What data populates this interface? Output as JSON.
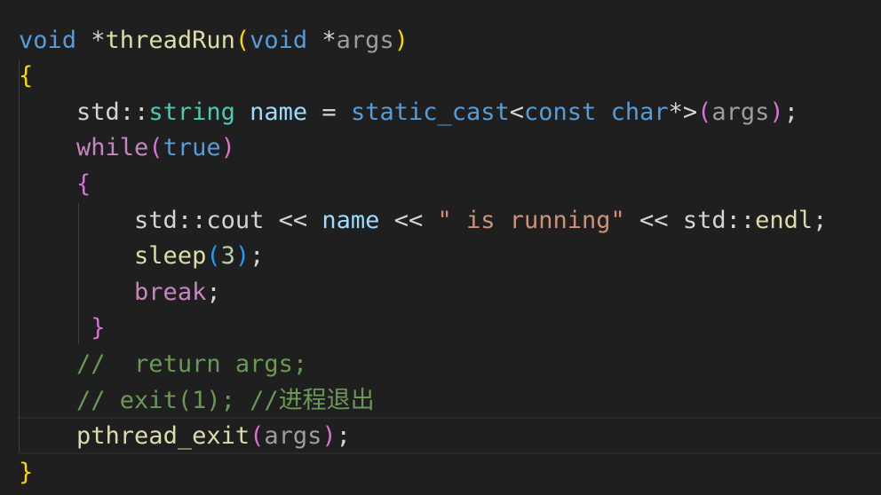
{
  "editor": {
    "language": "cpp",
    "theme": "dark",
    "background": "#1f1f1f",
    "lines": [
      [
        {
          "t": "void",
          "c": "kw"
        },
        {
          "t": " *",
          "c": "op"
        },
        {
          "t": "threadRun",
          "c": "fn"
        },
        {
          "t": "(",
          "c": "b1"
        },
        {
          "t": "void",
          "c": "kw"
        },
        {
          "t": " *",
          "c": "op"
        },
        {
          "t": "args",
          "c": "param"
        },
        {
          "t": ")",
          "c": "b1"
        }
      ],
      [
        {
          "t": "{",
          "c": "b1"
        }
      ],
      [
        {
          "t": "    "
        },
        {
          "t": "std",
          "c": "ns"
        },
        {
          "t": "::",
          "c": "op"
        },
        {
          "t": "string",
          "c": "ty"
        },
        {
          "t": " "
        },
        {
          "t": "name",
          "c": "var"
        },
        {
          "t": " = ",
          "c": "op"
        },
        {
          "t": "static_cast",
          "c": "kw"
        },
        {
          "t": "<",
          "c": "op"
        },
        {
          "t": "const",
          "c": "kw"
        },
        {
          "t": " "
        },
        {
          "t": "char",
          "c": "kw"
        },
        {
          "t": "*>",
          "c": "op"
        },
        {
          "t": "(",
          "c": "b2"
        },
        {
          "t": "args",
          "c": "param"
        },
        {
          "t": ")",
          "c": "b2"
        },
        {
          "t": ";",
          "c": "op"
        }
      ],
      [
        {
          "t": "    "
        },
        {
          "t": "while",
          "c": "ctl"
        },
        {
          "t": "(",
          "c": "b2"
        },
        {
          "t": "true",
          "c": "kw"
        },
        {
          "t": ")",
          "c": "b2"
        }
      ],
      [
        {
          "t": "    "
        },
        {
          "t": "{",
          "c": "b2"
        }
      ],
      [
        {
          "t": "        "
        },
        {
          "t": "std",
          "c": "ns"
        },
        {
          "t": "::",
          "c": "op"
        },
        {
          "t": "cout",
          "c": "ns"
        },
        {
          "t": " << ",
          "c": "op"
        },
        {
          "t": "name",
          "c": "var"
        },
        {
          "t": " << ",
          "c": "op"
        },
        {
          "t": "\" is running\"",
          "c": "str"
        },
        {
          "t": " << ",
          "c": "op"
        },
        {
          "t": "std",
          "c": "ns"
        },
        {
          "t": "::",
          "c": "op"
        },
        {
          "t": "endl",
          "c": "fn"
        },
        {
          "t": ";",
          "c": "op"
        }
      ],
      [
        {
          "t": "        "
        },
        {
          "t": "sleep",
          "c": "fn"
        },
        {
          "t": "(",
          "c": "b3"
        },
        {
          "t": "3",
          "c": "num"
        },
        {
          "t": ")",
          "c": "b3"
        },
        {
          "t": ";",
          "c": "op"
        }
      ],
      [
        {
          "t": "        "
        },
        {
          "t": "break",
          "c": "ctl"
        },
        {
          "t": ";",
          "c": "op"
        }
      ],
      [
        {
          "t": "     "
        },
        {
          "t": "}",
          "c": "b2"
        }
      ],
      [
        {
          "t": "    "
        },
        {
          "t": "//  return args;",
          "c": "cmt"
        }
      ],
      [
        {
          "t": "    "
        },
        {
          "t": "// exit(1); //进程退出",
          "c": "cmt"
        }
      ],
      [
        {
          "t": "    "
        },
        {
          "t": "pthread_exit",
          "c": "fn"
        },
        {
          "t": "(",
          "c": "b2"
        },
        {
          "t": "args",
          "c": "param"
        },
        {
          "t": ")",
          "c": "b2"
        },
        {
          "t": ";",
          "c": "op"
        }
      ],
      [
        {
          "t": "}",
          "c": "b1"
        }
      ]
    ],
    "cursor": {
      "line": 12,
      "after_token": 6
    }
  }
}
